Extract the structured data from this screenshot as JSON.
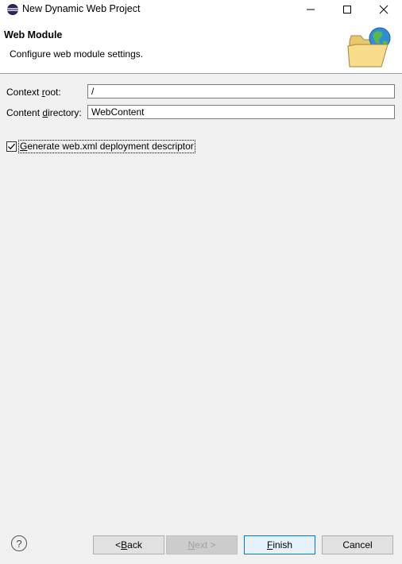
{
  "window": {
    "title": "New Dynamic Web Project",
    "minimize_glyph": "—",
    "maximize_glyph": "☐",
    "close_glyph": "✕"
  },
  "header": {
    "title": "Web Module",
    "description": "Configure web module settings.",
    "image_icon": "folder-globe-icon"
  },
  "form": {
    "context_root": {
      "label_pre": "Context ",
      "label_mnemonic": "r",
      "label_post": "oot:",
      "value": "/"
    },
    "content_directory": {
      "label_pre": "Content ",
      "label_mnemonic": "d",
      "label_post": "irectory:",
      "value": "WebContent"
    },
    "generate_webxml": {
      "label_mnemonic": "G",
      "label_rest": "enerate web.xml deployment descriptor",
      "checked": true
    }
  },
  "buttons": {
    "help": "?",
    "back_pre": "< ",
    "back_mnemonic": "B",
    "back_post": "ack",
    "next_mnemonic": "N",
    "next_post": "ext >",
    "finish_mnemonic": "F",
    "finish_post": "inish",
    "cancel": "Cancel"
  },
  "colors": {
    "accent": "#0078d7",
    "dialog_background": "#f0f0f0"
  }
}
